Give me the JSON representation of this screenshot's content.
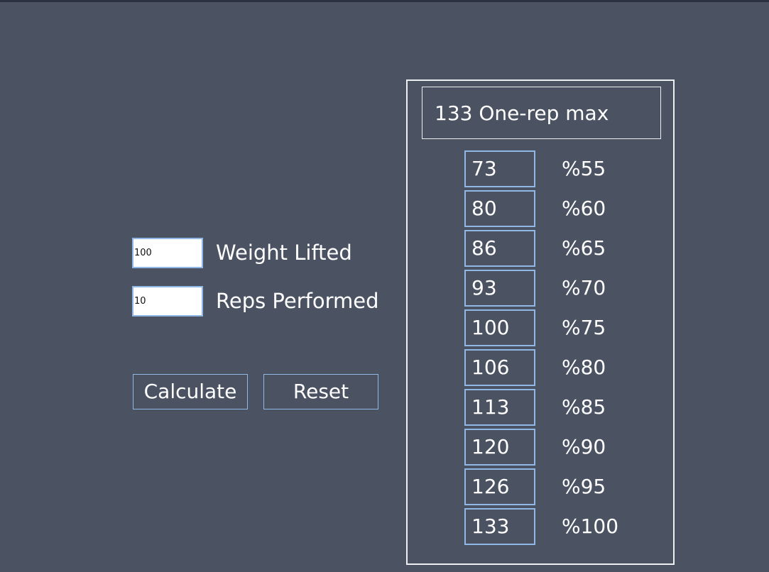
{
  "form": {
    "weight_value": "100",
    "weight_label": "Weight Lifted",
    "reps_value": "10",
    "reps_label": "Reps Performed",
    "calculate_label": "Calculate",
    "reset_label": "Reset"
  },
  "result": {
    "one_rep_max_value": "133",
    "one_rep_max_label": "One-rep max",
    "rows": [
      {
        "value": "73",
        "percent": "%55"
      },
      {
        "value": "80",
        "percent": "%60"
      },
      {
        "value": "86",
        "percent": "%65"
      },
      {
        "value": "93",
        "percent": "%70"
      },
      {
        "value": "100",
        "percent": "%75"
      },
      {
        "value": "106",
        "percent": "%80"
      },
      {
        "value": "113",
        "percent": "%85"
      },
      {
        "value": "120",
        "percent": "%90"
      },
      {
        "value": "126",
        "percent": "%95"
      },
      {
        "value": "133",
        "percent": "%100"
      }
    ]
  },
  "colors": {
    "background": "#4b5363",
    "accent_border": "#8fb8e6",
    "panel_border": "#eceef2",
    "text": "#ffffff"
  }
}
